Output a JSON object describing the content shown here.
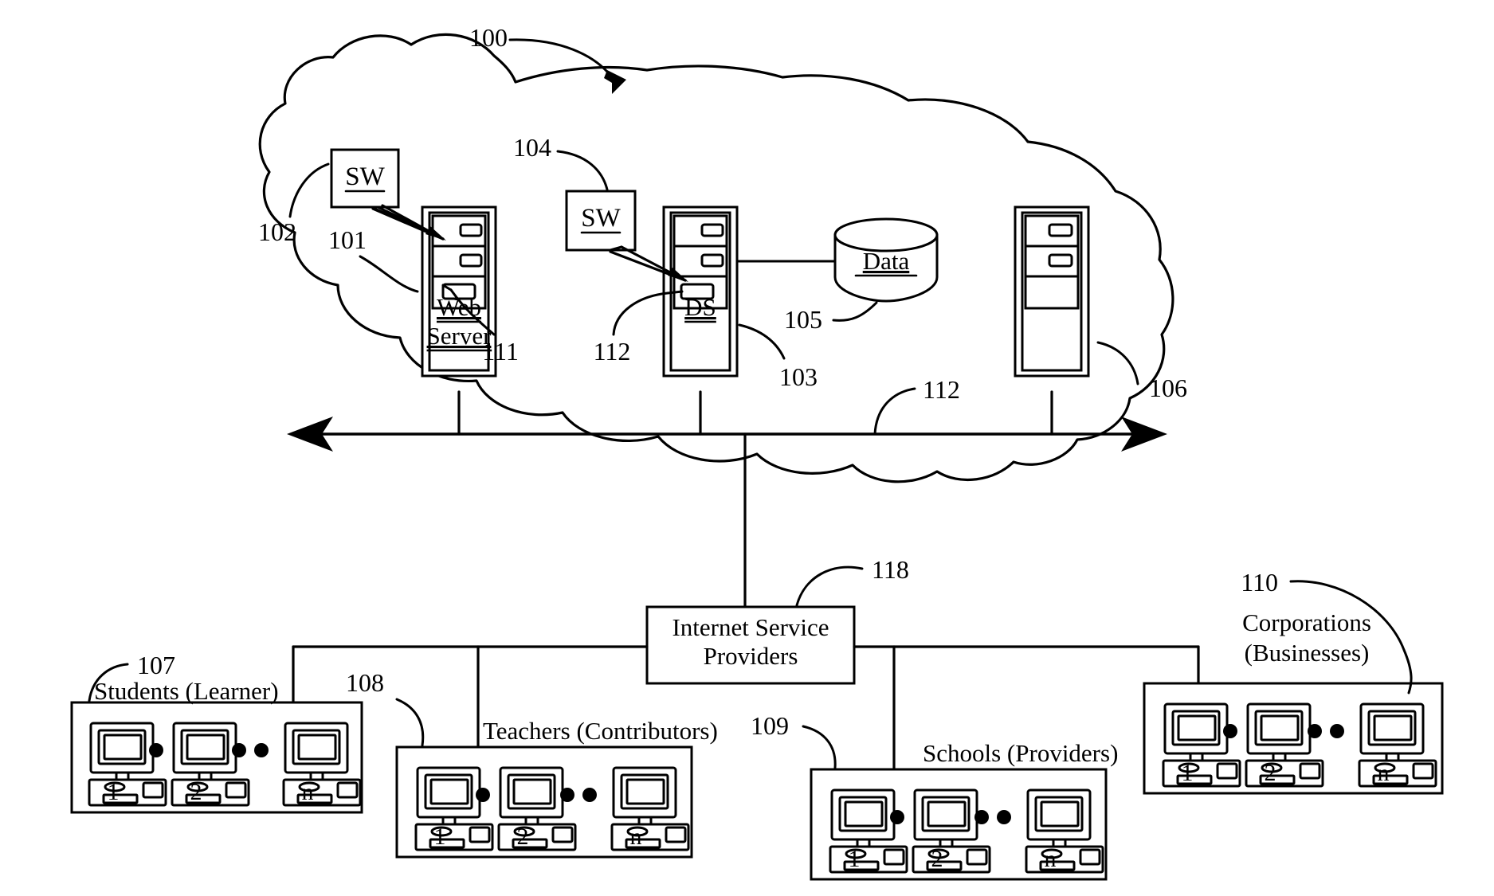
{
  "figure": {
    "type": "patent-network-diagram",
    "overall_ref": "100"
  },
  "cloud": {
    "ref": "100",
    "name": "internet-cloud"
  },
  "nodes": [
    {
      "id": "web-server",
      "label_line1": "Web",
      "label_line2": "Server",
      "ref": "101",
      "sw_label": "SW",
      "sw_ref": "102",
      "extra_ref": "111"
    },
    {
      "id": "ds-server",
      "label_line1": "DS",
      "label_line2": "",
      "ref": "103",
      "sw_label": "SW",
      "sw_ref": "104",
      "extra_ref": "112"
    },
    {
      "id": "third-server",
      "label_line1": "",
      "label_line2": "",
      "ref": "106",
      "sw_label": "",
      "sw_ref": "",
      "extra_ref": ""
    }
  ],
  "database": {
    "label": "Data",
    "ref": "105"
  },
  "bus": {
    "ref": "112",
    "name": "network-backbone"
  },
  "isp": {
    "label_line1": "Internet Service",
    "label_line2": "Providers",
    "ref": "118"
  },
  "groups": [
    {
      "id": "students",
      "label": "Students (Learner)",
      "label_line2": "",
      "ref": "107",
      "pcs": [
        "1",
        "2",
        "n"
      ]
    },
    {
      "id": "teachers",
      "label": "Teachers (Contributors)",
      "label_line2": "",
      "ref": "108",
      "pcs": [
        "1",
        "2",
        "n"
      ]
    },
    {
      "id": "schools",
      "label": "Schools (Providers)",
      "label_line2": "",
      "ref": "109",
      "pcs": [
        "1",
        "2",
        "n"
      ]
    },
    {
      "id": "corporations",
      "label": "Corporations",
      "label_line2": "(Businesses)",
      "ref": "110",
      "pcs": [
        "1",
        "2",
        "n"
      ]
    }
  ],
  "colors": {
    "ink": "#000000",
    "paper": "#ffffff"
  }
}
